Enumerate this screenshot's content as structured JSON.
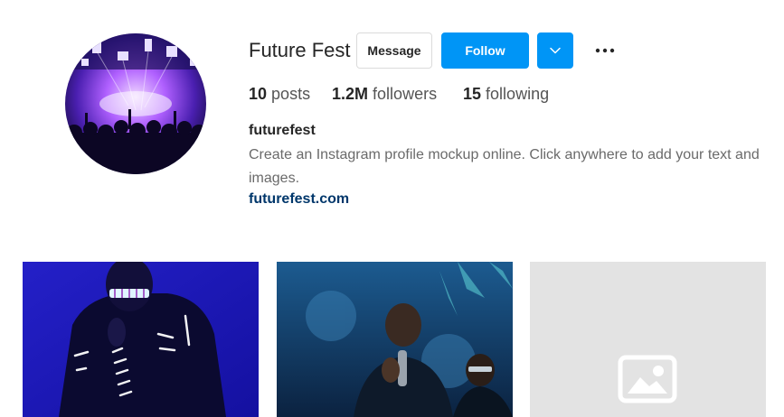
{
  "profile": {
    "username": "Future Fest",
    "full_name": "futurefest",
    "bio": "Create an Instagram profile mockup online. Click anywhere to add your text and images.",
    "website": "futurefest.com"
  },
  "actions": {
    "message_label": "Message",
    "follow_label": "Follow",
    "dropdown_icon": "chevron-down-icon",
    "more_icon": "more-options-icon"
  },
  "stats": {
    "posts_count": "10",
    "posts_label": "posts",
    "followers_count": "1.2M",
    "followers_label": "followers",
    "following_count": "15",
    "following_label": "following"
  },
  "posts": [
    {
      "kind": "photo",
      "subject": "performer in LED suit"
    },
    {
      "kind": "photo",
      "subject": "rapper with microphone"
    },
    {
      "kind": "placeholder",
      "icon": "image-placeholder-icon"
    }
  ],
  "colors": {
    "accent": "#0095f6",
    "link": "#00376b",
    "placeholder_bg": "#e3e3e3"
  }
}
